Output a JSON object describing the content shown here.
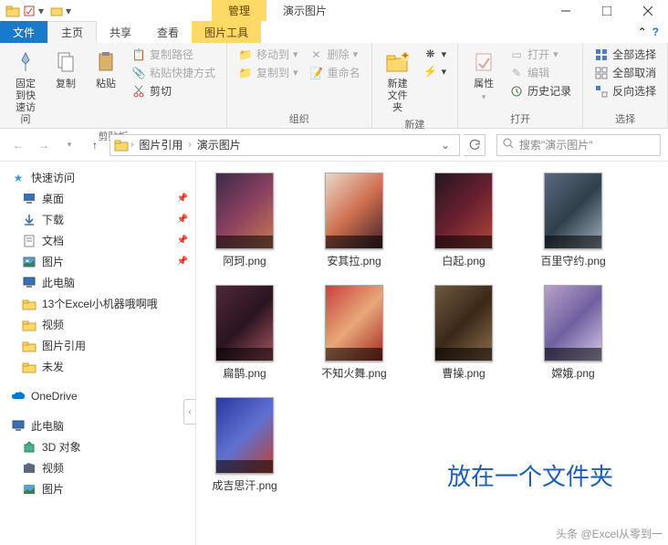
{
  "context_tab": "管理",
  "context_title": "演示图片",
  "tabs": {
    "file": "文件",
    "home": "主页",
    "share": "共享",
    "view": "查看",
    "tools": "图片工具"
  },
  "ribbon": {
    "clipboard": {
      "pin": "固定到快\n速访问",
      "copy": "复制",
      "paste": "粘贴",
      "copy_path": "复制路径",
      "paste_shortcut": "粘贴快捷方式",
      "cut": "剪切",
      "label": "剪贴板"
    },
    "organize": {
      "move_to": "移动到",
      "copy_to": "复制到",
      "delete": "删除",
      "rename": "重命名",
      "label": "组织"
    },
    "new": {
      "new_folder": "新建\n文件夹",
      "label": "新建"
    },
    "open": {
      "properties": "属性",
      "open": "打开",
      "edit": "编辑",
      "history": "历史记录",
      "label": "打开"
    },
    "select": {
      "select_all": "全部选择",
      "select_none": "全部取消",
      "invert": "反向选择",
      "label": "选择"
    }
  },
  "breadcrumb": {
    "seg1": "图片引用",
    "seg2": "演示图片"
  },
  "search_placeholder": "搜索\"演示图片\"",
  "sidebar": {
    "quick": "快速访问",
    "items1": [
      "桌面",
      "下载",
      "文档",
      "图片"
    ],
    "items2": [
      "此电脑",
      "13个Excel小机器哦啊哦",
      "视频",
      "图片引用",
      "未发"
    ],
    "onedrive": "OneDrive",
    "thispc": "此电脑",
    "items3": [
      "3D 对象",
      "视频",
      "图片"
    ]
  },
  "files": [
    {
      "name": "阿珂.png",
      "t": "t1"
    },
    {
      "name": "安其拉.png",
      "t": "t2"
    },
    {
      "name": "白起.png",
      "t": "t3"
    },
    {
      "name": "百里守约.png",
      "t": "t4"
    },
    {
      "name": "扁鹊.png",
      "t": "t5"
    },
    {
      "name": "不知火舞.png",
      "t": "t6"
    },
    {
      "name": "曹操.png",
      "t": "t7"
    },
    {
      "name": "嫦娥.png",
      "t": "t8"
    },
    {
      "name": "成吉思汗.png",
      "t": "t9"
    }
  ],
  "overlay": "放在一个文件夹",
  "watermark": "头条 @Excel从零到一"
}
